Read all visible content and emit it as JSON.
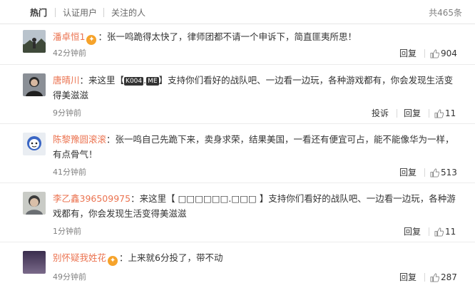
{
  "tabs": {
    "hot": "热门",
    "verified": "认证用户",
    "following": "关注的人",
    "total": "共465条"
  },
  "comments": [
    {
      "user": "潘卓恒1",
      "colon": "：",
      "text": "张一鸣跪得太快了，律师团都不请一个申诉下，简直匪夷所思！",
      "time": "42分钟前",
      "reply": "回复",
      "likes": "904"
    },
    {
      "user": "唐晴川",
      "colon": "：",
      "text_pre": "来这里【",
      "tag1": "K004",
      "dot": ".",
      "tag2": "ME",
      "text_post": "】支持你们看好的战队吧、一边看一边玩，各种游戏都有，你会发现生活变得美滋滋",
      "time": "9分钟前",
      "report": "投诉",
      "reply": "回复",
      "likes": "11"
    },
    {
      "user": "陈黎豫圆滚滚",
      "colon": "：",
      "text": "张一鸣自己先跪下来，卖身求荣，结果美国，一看还有便宜可占，能不能像华为一样，有点骨气！",
      "time": "41分钟前",
      "reply": "回复",
      "likes": "513"
    },
    {
      "user": "李乙鑫396509975",
      "colon": "：",
      "text": "来这里【 □□□□□□.□□□ 】支持你们看好的战队吧、一边看一边玩，各种游戏都有，你会发现生活变得美滋滋",
      "time": "1分钟前",
      "reply": "回复",
      "likes": "11"
    },
    {
      "user": "别怀疑我姓花",
      "colon": "：",
      "text": "上来就6分投了，带不动",
      "time": "49分钟前",
      "reply": "回复",
      "likes": "287"
    }
  ],
  "colors": {
    "username": "#eb7350",
    "badge": "#f6a32b"
  }
}
